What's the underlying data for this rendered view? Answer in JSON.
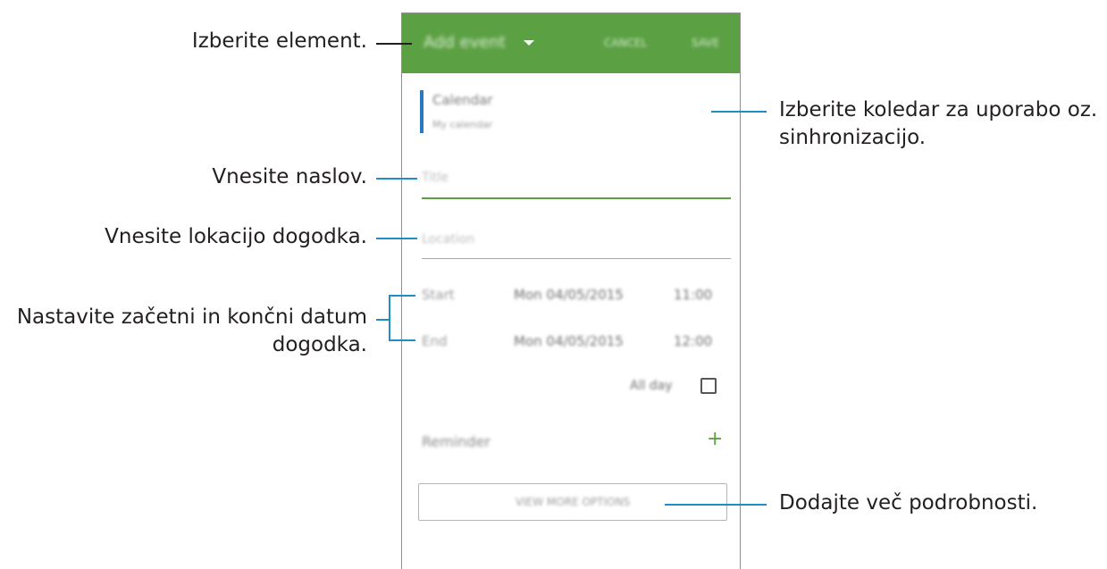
{
  "app": {
    "title": "Add event",
    "cancel": "CANCEL",
    "save": "SAVE",
    "accent_color": "#5ca044",
    "calendar_color": "#2a78c2"
  },
  "form": {
    "calendar_label": "Calendar",
    "calendar_value": "My calendar",
    "title_placeholder": "Title",
    "location_placeholder": "Location",
    "start_label": "Start",
    "start_date": "Mon 04/05/2015",
    "start_time": "11:00",
    "end_label": "End",
    "end_date": "Mon 04/05/2015",
    "end_time": "12:00",
    "all_day_label": "All day",
    "all_day_checked": false,
    "reminder_label": "Reminder",
    "add_reminder_icon": "plus-icon",
    "more_options": "VIEW MORE OPTIONS"
  },
  "callouts": {
    "select_item": "Izberite element.",
    "select_calendar": "Izberite koledar za uporabo oz.",
    "select_calendar_2": "sinhronizacijo.",
    "enter_title": "Vnesite naslov.",
    "enter_location": "Vnesite lokacijo dogodka.",
    "set_dates": "Nastavite začetni in končni datum",
    "set_dates_2": "dogodka.",
    "add_details": "Dodajte več podrobnosti."
  }
}
